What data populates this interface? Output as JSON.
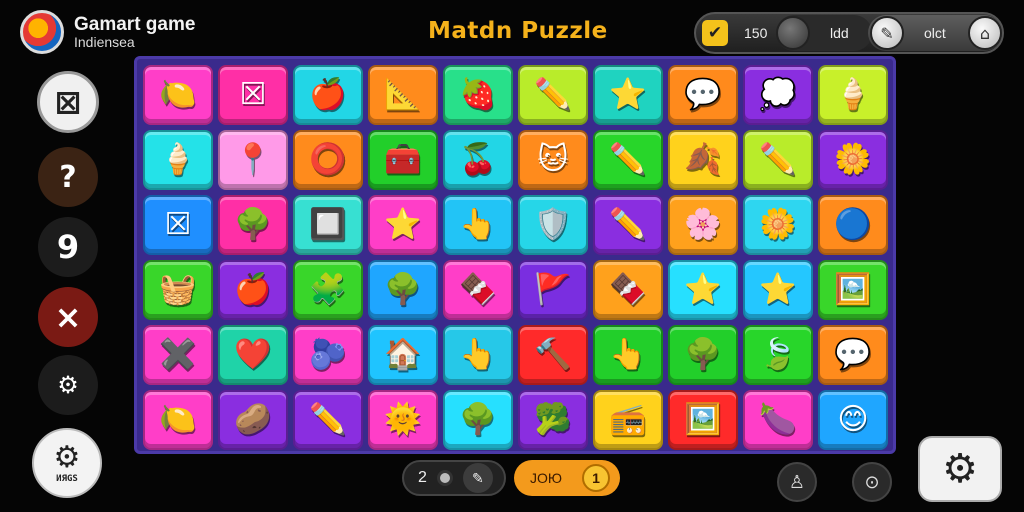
{
  "brand": {
    "title": "Gamart game",
    "subtitle": "Indiensea"
  },
  "game_title": "Matdn Puzzle",
  "status_bar": {
    "icon": "checkbox-icon",
    "value_1": "150",
    "value_2": "ldd",
    "value_3": "olct"
  },
  "side_buttons": {
    "puzzle_icon": "puzzle-icon",
    "help_glyph": "?",
    "nine_glyph": "9",
    "close_glyph": "×",
    "gear_glyph": "⚙",
    "big_gear_glyph": "⚙",
    "big_gear_label": "ИЯGS"
  },
  "board": {
    "rows": 6,
    "cols": 10,
    "tiles": [
      {
        "color": "#ff3ec8",
        "icon": "🍋"
      },
      {
        "color": "#ff2fa6",
        "icon": "☒"
      },
      {
        "color": "#22d6e6",
        "icon": "🍎"
      },
      {
        "color": "#ff8b1c",
        "icon": "📐"
      },
      {
        "color": "#28e08a",
        "icon": "🍓"
      },
      {
        "color": "#b9ec2a",
        "icon": "✏️"
      },
      {
        "color": "#1fd3c0",
        "icon": "⭐"
      },
      {
        "color": "#ff8a1c",
        "icon": "💬"
      },
      {
        "color": "#8a2ee0",
        "icon": "💭"
      },
      {
        "color": "#c8f02a",
        "icon": "🍦"
      },
      {
        "color": "#24e2e8",
        "icon": "🍦"
      },
      {
        "color": "#ff9ae8",
        "icon": "📍"
      },
      {
        "color": "#ff8b1c",
        "icon": "⭕"
      },
      {
        "color": "#22cf2a",
        "icon": "🧰"
      },
      {
        "color": "#22d6e6",
        "icon": "🍒"
      },
      {
        "color": "#ff8b1c",
        "icon": "🐱"
      },
      {
        "color": "#28d62a",
        "icon": "✏️"
      },
      {
        "color": "#ffd21c",
        "icon": "🍂"
      },
      {
        "color": "#b9ec2a",
        "icon": "✏️"
      },
      {
        "color": "#8a2ee0",
        "icon": "🌼"
      },
      {
        "color": "#1f8fff",
        "icon": "☒"
      },
      {
        "color": "#ff2fa6",
        "icon": "🌳"
      },
      {
        "color": "#37e0d2",
        "icon": "🔲"
      },
      {
        "color": "#ff3ec8",
        "icon": "⭐"
      },
      {
        "color": "#22c4f6",
        "icon": "👆"
      },
      {
        "color": "#26d6e8",
        "icon": "🛡️"
      },
      {
        "color": "#8a2ee0",
        "icon": "✏️"
      },
      {
        "color": "#ffa11c",
        "icon": "🌸"
      },
      {
        "color": "#2ed6f0",
        "icon": "🌼"
      },
      {
        "color": "#ff8b1c",
        "icon": "🔵"
      },
      {
        "color": "#39d62a",
        "icon": "🧺"
      },
      {
        "color": "#8a2ee0",
        "icon": "🍎"
      },
      {
        "color": "#39d62a",
        "icon": "🧩"
      },
      {
        "color": "#1fa6ff",
        "icon": "🌳"
      },
      {
        "color": "#ff3ec8",
        "icon": "🍫"
      },
      {
        "color": "#7a2ee0",
        "icon": "🚩"
      },
      {
        "color": "#ffa11c",
        "icon": "🍫"
      },
      {
        "color": "#26e0ff",
        "icon": "⭐"
      },
      {
        "color": "#24c7ff",
        "icon": "⭐"
      },
      {
        "color": "#39d62a",
        "icon": "🖼️"
      },
      {
        "color": "#ff3ec8",
        "icon": "✖️"
      },
      {
        "color": "#1fd3a8",
        "icon": "❤️"
      },
      {
        "color": "#ff3ec8",
        "icon": "🫐"
      },
      {
        "color": "#1fc4ff",
        "icon": "🏠"
      },
      {
        "color": "#26c8e8",
        "icon": "👆"
      },
      {
        "color": "#ff2a2a",
        "icon": "🔨"
      },
      {
        "color": "#22cf2a",
        "icon": "👆"
      },
      {
        "color": "#22cf2a",
        "icon": "🌳"
      },
      {
        "color": "#28d62a",
        "icon": "🍃"
      },
      {
        "color": "#ff8b1c",
        "icon": "💬"
      },
      {
        "color": "#ff3ec8",
        "icon": "🍋"
      },
      {
        "color": "#8a2ee0",
        "icon": "🥔"
      },
      {
        "color": "#8a2ee0",
        "icon": "✏️"
      },
      {
        "color": "#ff3ec8",
        "icon": "🌞"
      },
      {
        "color": "#26e0ff",
        "icon": "🌳"
      },
      {
        "color": "#8a2ee0",
        "icon": "🥦"
      },
      {
        "color": "#ffd21c",
        "icon": "📻"
      },
      {
        "color": "#ff2a2a",
        "icon": "🖼️"
      },
      {
        "color": "#ff3ec8",
        "icon": "🍆"
      },
      {
        "color": "#1fa6ff",
        "icon": "😊"
      }
    ]
  },
  "bottom": {
    "counter": "2",
    "pen_icon": "✎",
    "score_label": "ЈОЮ",
    "coin_value": "1",
    "round_btn_1": "♙",
    "round_btn_2": "⊙",
    "settings_glyph": "⚙"
  }
}
